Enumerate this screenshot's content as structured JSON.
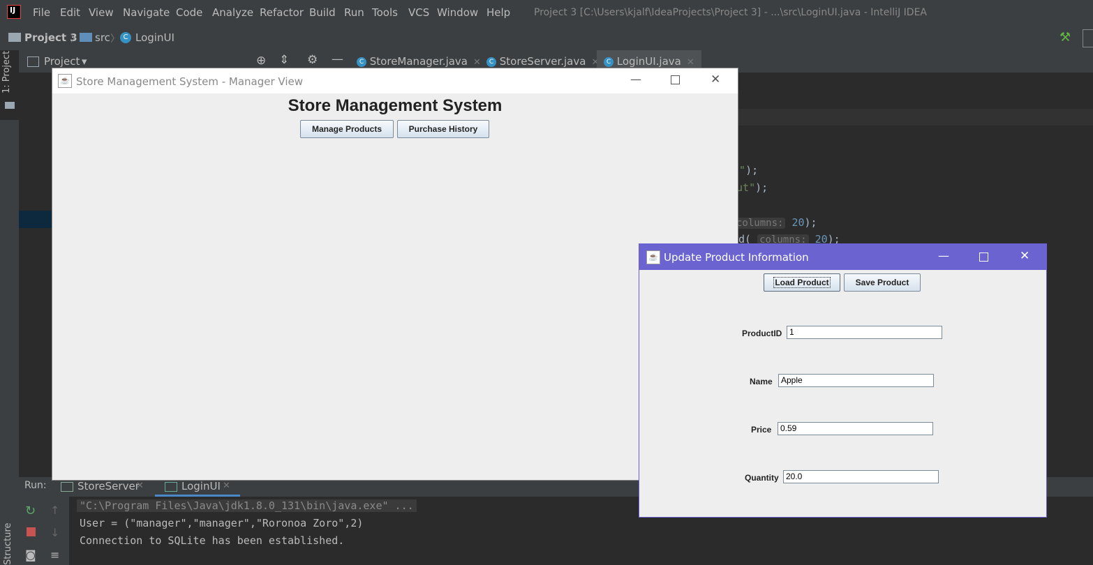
{
  "menubar": {
    "items": [
      "File",
      "Edit",
      "View",
      "Navigate",
      "Code",
      "Analyze",
      "Refactor",
      "Build",
      "Run",
      "Tools",
      "VCS",
      "Window",
      "Help"
    ],
    "window_title": "Project 3 [C:\\Users\\kjalf\\IdeaProjects\\Project 3] - ...\\src\\LoginUI.java - IntelliJ IDEA"
  },
  "breadcrumb": {
    "project": "Project 3",
    "folder": "src",
    "file": "LoginUI"
  },
  "left_toolstrip": {
    "project_label": "1: Project",
    "structure_label": "Structure"
  },
  "project_panel": {
    "title": "Project"
  },
  "editor_tabs": [
    {
      "label": "StoreManager.java"
    },
    {
      "label": "StoreServer.java"
    },
    {
      "label": "LoginUI.java"
    }
  ],
  "code_fragments": {
    "line1_str": "n\"",
    "line1_end": ");",
    "line2_str": "out\"",
    "line2_end": ");",
    "line3_hint": "columns:",
    "line3_num": "20",
    "line3_end": ");",
    "line4_pre": "d(",
    "line4_hint": "columns:",
    "line4_num": "20",
    "line4_end": ");"
  },
  "run_panel": {
    "label": "Run:",
    "tabs": [
      {
        "label": "StoreServer"
      },
      {
        "label": "LoginUI"
      }
    ],
    "console_lines": [
      "\"C:\\Program Files\\Java\\jdk1.8.0_131\\bin\\java.exe\" ...",
      "User = (\"manager\",\"manager\",\"Roronoa Zoro\",2)",
      "Connection to SQLite has been established."
    ]
  },
  "manager_window": {
    "title": "Store Management System - Manager View",
    "heading": "Store Management System",
    "buttons": {
      "manage_products": "Manage Products",
      "purchase_history": "Purchase History"
    }
  },
  "update_window": {
    "title": "Update Product Information",
    "buttons": {
      "load": "Load Product",
      "save": "Save Product"
    },
    "fields": {
      "product_id": {
        "label": "ProductID",
        "value": "1"
      },
      "name": {
        "label": "Name",
        "value": "Apple"
      },
      "price": {
        "label": "Price",
        "value": "0.59"
      },
      "quantity": {
        "label": "Quantity",
        "value": "20.0"
      }
    }
  },
  "colors": {
    "ide_bg": "#2b2b2b",
    "ide_panel": "#3c3f41",
    "active_title": "#6a63d0",
    "swing_bg": "#eeeeee"
  }
}
